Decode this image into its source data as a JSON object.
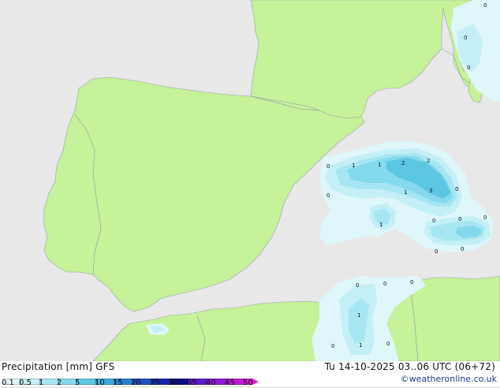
{
  "header": {
    "title": "Precipitation [mm]  GFS",
    "validity": "Tu 14-10-2025 03..06 UTC (06+72)",
    "credit": "©weatheronline.co.uk"
  },
  "legend": {
    "ticks": [
      "0.1",
      "0.5",
      "1",
      "2",
      "5",
      "10",
      "15",
      "20",
      "25",
      "30",
      "35",
      "40",
      "45",
      "50"
    ],
    "colors": [
      "#dff6fa",
      "#c4eff7",
      "#a6e6f2",
      "#84d9ec",
      "#5cc6e3",
      "#3ba8db",
      "#2a7fd0",
      "#1d4fc0",
      "#1626a8",
      "#0a0a86",
      "#5a18c8",
      "#8e1ad8",
      "#c018d8",
      "#e01ad4"
    ]
  },
  "map": {
    "colors": {
      "sea": "#e8e8e8",
      "land": "#c6f29a",
      "border": "#9aa4a4"
    },
    "values": [
      {
        "label": "0"
      },
      {
        "label": "1"
      },
      {
        "label": "1"
      },
      {
        "label": "2"
      },
      {
        "label": "2"
      },
      {
        "label": "0"
      },
      {
        "label": "1"
      },
      {
        "label": "3"
      },
      {
        "label": "0"
      },
      {
        "label": "1"
      },
      {
        "label": "0"
      },
      {
        "label": "0"
      },
      {
        "label": "0"
      },
      {
        "label": "0"
      },
      {
        "label": "0"
      },
      {
        "label": "0"
      },
      {
        "label": "0"
      },
      {
        "label": "0"
      },
      {
        "label": "1"
      },
      {
        "label": "0"
      },
      {
        "label": "1"
      },
      {
        "label": "0"
      },
      {
        "label": "0"
      },
      {
        "label": "0"
      },
      {
        "label": "0"
      }
    ]
  }
}
